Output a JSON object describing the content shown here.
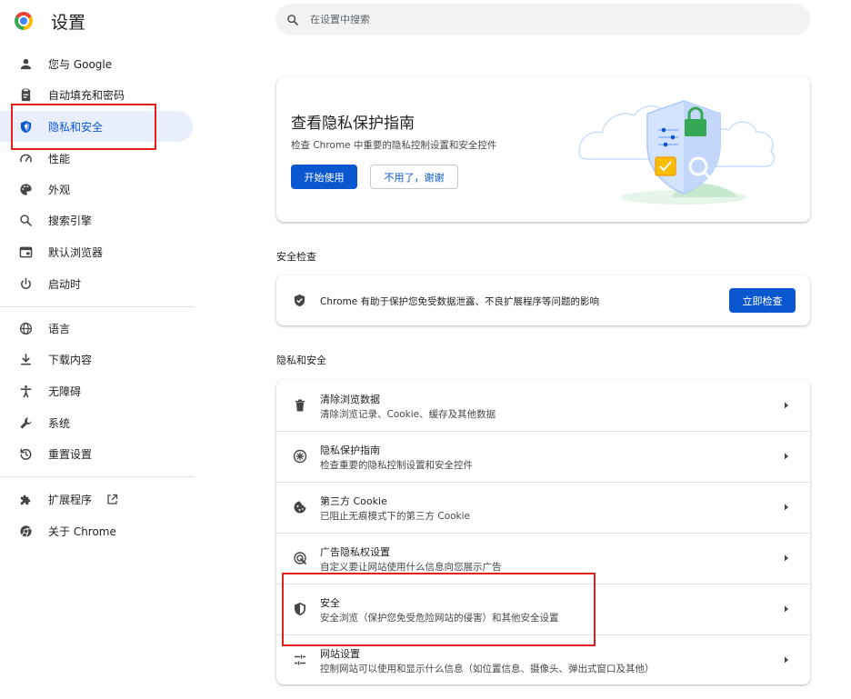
{
  "app": {
    "title": "设置",
    "icon": "chrome-logo-icon"
  },
  "search": {
    "placeholder": "在设置中搜索"
  },
  "sidebar": {
    "items": [
      {
        "label": "您与 Google",
        "icon": "person-icon"
      },
      {
        "label": "自动填充和密码",
        "icon": "clipboard-icon"
      },
      {
        "label": "隐私和安全",
        "icon": "shield-icon",
        "active": true
      },
      {
        "label": "性能",
        "icon": "speedometer-icon"
      },
      {
        "label": "外观",
        "icon": "palette-icon"
      },
      {
        "label": "搜索引擎",
        "icon": "search-icon"
      },
      {
        "label": "默认浏览器",
        "icon": "browser-window-icon"
      },
      {
        "label": "启动时",
        "icon": "power-icon"
      },
      {
        "label": "语言",
        "icon": "globe-icon"
      },
      {
        "label": "下载内容",
        "icon": "download-icon"
      },
      {
        "label": "无障碍",
        "icon": "accessibility-icon"
      },
      {
        "label": "系统",
        "icon": "wrench-icon"
      },
      {
        "label": "重置设置",
        "icon": "reset-icon"
      },
      {
        "label": "扩展程序",
        "icon": "puzzle-icon",
        "external": true
      },
      {
        "label": "关于 Chrome",
        "icon": "chrome-icon"
      }
    ]
  },
  "promo": {
    "title": "查看隐私保护指南",
    "description": "检查 Chrome 中重要的隐私控制设置和安全控件",
    "primary_button": "开始使用",
    "secondary_button": "不用了，谢谢"
  },
  "safety_check": {
    "section_title": "安全检查",
    "text": "Chrome 有助于保护您免受数据泄露、不良扩展程序等问题的影响",
    "button": "立即检查"
  },
  "privacy": {
    "section_title": "隐私和安全",
    "rows": [
      {
        "title": "清除浏览数据",
        "subtitle": "清除浏览记录、Cookie、缓存及其他数据",
        "icon": "trash-icon"
      },
      {
        "title": "隐私保护指南",
        "subtitle": "检查重要的隐私控制设置和安全控件",
        "icon": "compass-icon"
      },
      {
        "title": "第三方 Cookie",
        "subtitle": "已阻止无痕模式下的第三方 Cookie",
        "icon": "cookie-icon"
      },
      {
        "title": "广告隐私权设置",
        "subtitle": "自定义要让网站使用什么信息向您展示广告",
        "icon": "ad-privacy-icon"
      },
      {
        "title": "安全",
        "subtitle": "安全浏览（保护您免受危险网站的侵害）和其他安全设置",
        "icon": "shield-half-icon"
      },
      {
        "title": "网站设置",
        "subtitle": "控制网站可以使用和显示什么信息（如位置信息、摄像头、弹出式窗口及其他）",
        "icon": "sliders-icon"
      }
    ]
  },
  "colors": {
    "accent": "#0b57d0",
    "active_bg": "#e8eefb",
    "highlight": "#e0201c"
  }
}
